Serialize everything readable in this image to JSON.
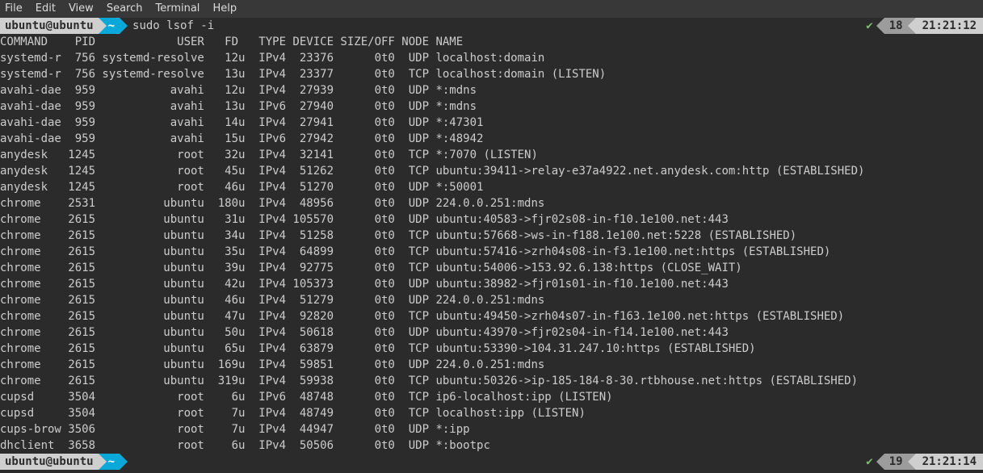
{
  "menu": {
    "items": [
      "File",
      "Edit",
      "View",
      "Search",
      "Terminal",
      "Help"
    ]
  },
  "prompt1": {
    "userhost": "ubuntu@ubuntu",
    "dir": "~",
    "command": "sudo lsof -i",
    "status_num": "18",
    "time": "21:21:12"
  },
  "prompt2": {
    "userhost": "ubuntu@ubuntu",
    "dir": "~",
    "status_num": "19",
    "time": "21:21:14"
  },
  "header": "COMMAND    PID            USER   FD   TYPE DEVICE SIZE/OFF NODE NAME",
  "rows": [
    {
      "cmd": "systemd-r",
      "pid": "756",
      "user": "systemd-resolve",
      "fd": "12u",
      "type": "IPv4",
      "dev": "23376",
      "szoff": "0t0",
      "node": "UDP",
      "name": "localhost:domain"
    },
    {
      "cmd": "systemd-r",
      "pid": "756",
      "user": "systemd-resolve",
      "fd": "13u",
      "type": "IPv4",
      "dev": "23377",
      "szoff": "0t0",
      "node": "TCP",
      "name": "localhost:domain (LISTEN)"
    },
    {
      "cmd": "avahi-dae",
      "pid": "959",
      "user": "avahi",
      "fd": "12u",
      "type": "IPv4",
      "dev": "27939",
      "szoff": "0t0",
      "node": "UDP",
      "name": "*:mdns"
    },
    {
      "cmd": "avahi-dae",
      "pid": "959",
      "user": "avahi",
      "fd": "13u",
      "type": "IPv6",
      "dev": "27940",
      "szoff": "0t0",
      "node": "UDP",
      "name": "*:mdns"
    },
    {
      "cmd": "avahi-dae",
      "pid": "959",
      "user": "avahi",
      "fd": "14u",
      "type": "IPv4",
      "dev": "27941",
      "szoff": "0t0",
      "node": "UDP",
      "name": "*:47301"
    },
    {
      "cmd": "avahi-dae",
      "pid": "959",
      "user": "avahi",
      "fd": "15u",
      "type": "IPv6",
      "dev": "27942",
      "szoff": "0t0",
      "node": "UDP",
      "name": "*:48942"
    },
    {
      "cmd": "anydesk",
      "pid": "1245",
      "user": "root",
      "fd": "32u",
      "type": "IPv4",
      "dev": "32141",
      "szoff": "0t0",
      "node": "TCP",
      "name": "*:7070 (LISTEN)"
    },
    {
      "cmd": "anydesk",
      "pid": "1245",
      "user": "root",
      "fd": "45u",
      "type": "IPv4",
      "dev": "51262",
      "szoff": "0t0",
      "node": "TCP",
      "name": "ubuntu:39411->relay-e37a4922.net.anydesk.com:http (ESTABLISHED)"
    },
    {
      "cmd": "anydesk",
      "pid": "1245",
      "user": "root",
      "fd": "46u",
      "type": "IPv4",
      "dev": "51270",
      "szoff": "0t0",
      "node": "UDP",
      "name": "*:50001"
    },
    {
      "cmd": "chrome",
      "pid": "2531",
      "user": "ubuntu",
      "fd": "180u",
      "type": "IPv4",
      "dev": "48956",
      "szoff": "0t0",
      "node": "UDP",
      "name": "224.0.0.251:mdns"
    },
    {
      "cmd": "chrome",
      "pid": "2615",
      "user": "ubuntu",
      "fd": "31u",
      "type": "IPv4",
      "dev": "105570",
      "szoff": "0t0",
      "node": "UDP",
      "name": "ubuntu:40583->fjr02s08-in-f10.1e100.net:443"
    },
    {
      "cmd": "chrome",
      "pid": "2615",
      "user": "ubuntu",
      "fd": "34u",
      "type": "IPv4",
      "dev": "51258",
      "szoff": "0t0",
      "node": "TCP",
      "name": "ubuntu:57668->ws-in-f188.1e100.net:5228 (ESTABLISHED)"
    },
    {
      "cmd": "chrome",
      "pid": "2615",
      "user": "ubuntu",
      "fd": "35u",
      "type": "IPv4",
      "dev": "64899",
      "szoff": "0t0",
      "node": "TCP",
      "name": "ubuntu:57416->zrh04s08-in-f3.1e100.net:https (ESTABLISHED)"
    },
    {
      "cmd": "chrome",
      "pid": "2615",
      "user": "ubuntu",
      "fd": "39u",
      "type": "IPv4",
      "dev": "92775",
      "szoff": "0t0",
      "node": "TCP",
      "name": "ubuntu:54006->153.92.6.138:https (CLOSE_WAIT)"
    },
    {
      "cmd": "chrome",
      "pid": "2615",
      "user": "ubuntu",
      "fd": "42u",
      "type": "IPv4",
      "dev": "105373",
      "szoff": "0t0",
      "node": "UDP",
      "name": "ubuntu:38982->fjr01s01-in-f10.1e100.net:443"
    },
    {
      "cmd": "chrome",
      "pid": "2615",
      "user": "ubuntu",
      "fd": "46u",
      "type": "IPv4",
      "dev": "51279",
      "szoff": "0t0",
      "node": "UDP",
      "name": "224.0.0.251:mdns"
    },
    {
      "cmd": "chrome",
      "pid": "2615",
      "user": "ubuntu",
      "fd": "47u",
      "type": "IPv4",
      "dev": "92820",
      "szoff": "0t0",
      "node": "TCP",
      "name": "ubuntu:49450->zrh04s07-in-f163.1e100.net:https (ESTABLISHED)"
    },
    {
      "cmd": "chrome",
      "pid": "2615",
      "user": "ubuntu",
      "fd": "50u",
      "type": "IPv4",
      "dev": "50618",
      "szoff": "0t0",
      "node": "UDP",
      "name": "ubuntu:43970->fjr02s04-in-f14.1e100.net:443"
    },
    {
      "cmd": "chrome",
      "pid": "2615",
      "user": "ubuntu",
      "fd": "65u",
      "type": "IPv4",
      "dev": "63879",
      "szoff": "0t0",
      "node": "TCP",
      "name": "ubuntu:53390->104.31.247.10:https (ESTABLISHED)"
    },
    {
      "cmd": "chrome",
      "pid": "2615",
      "user": "ubuntu",
      "fd": "169u",
      "type": "IPv4",
      "dev": "59851",
      "szoff": "0t0",
      "node": "UDP",
      "name": "224.0.0.251:mdns"
    },
    {
      "cmd": "chrome",
      "pid": "2615",
      "user": "ubuntu",
      "fd": "319u",
      "type": "IPv4",
      "dev": "59938",
      "szoff": "0t0",
      "node": "TCP",
      "name": "ubuntu:50326->ip-185-184-8-30.rtbhouse.net:https (ESTABLISHED)"
    },
    {
      "cmd": "cupsd",
      "pid": "3504",
      "user": "root",
      "fd": "6u",
      "type": "IPv6",
      "dev": "48748",
      "szoff": "0t0",
      "node": "TCP",
      "name": "ip6-localhost:ipp (LISTEN)"
    },
    {
      "cmd": "cupsd",
      "pid": "3504",
      "user": "root",
      "fd": "7u",
      "type": "IPv4",
      "dev": "48749",
      "szoff": "0t0",
      "node": "TCP",
      "name": "localhost:ipp (LISTEN)"
    },
    {
      "cmd": "cups-brow",
      "pid": "3506",
      "user": "root",
      "fd": "7u",
      "type": "IPv4",
      "dev": "44947",
      "szoff": "0t0",
      "node": "UDP",
      "name": "*:ipp"
    },
    {
      "cmd": "dhclient",
      "pid": "3658",
      "user": "root",
      "fd": "6u",
      "type": "IPv4",
      "dev": "50506",
      "szoff": "0t0",
      "node": "UDP",
      "name": "*:bootpc"
    }
  ]
}
